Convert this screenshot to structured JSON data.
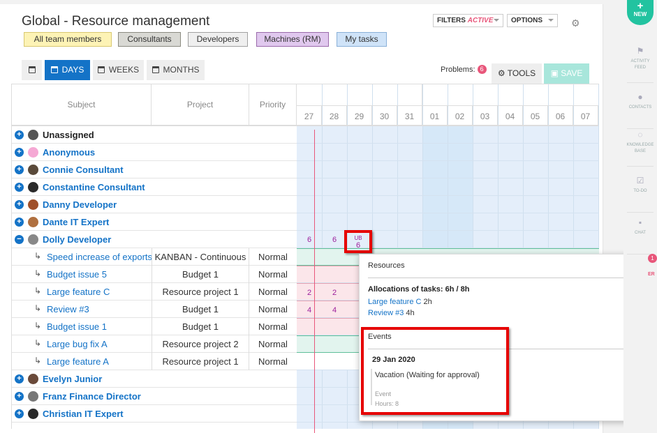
{
  "header": {
    "title": "Global - Resource management",
    "filters_label": "FILTERS",
    "filters_state": "ACTIVE",
    "options_label": "OPTIONS"
  },
  "chips": [
    {
      "label": "All team members",
      "bg": "#fdf3b5",
      "border": "#d8c870"
    },
    {
      "label": "Consultants",
      "bg": "#d9d9d4",
      "border": "#8a8a80"
    },
    {
      "label": "Developers",
      "bg": "#efefef",
      "border": "#a0a0a0"
    },
    {
      "label": "Machines (RM)",
      "bg": "#e0c8ee",
      "border": "#9a6aaa"
    },
    {
      "label": "My tasks",
      "bg": "#cfe3f8",
      "border": "#8ab0d8"
    }
  ],
  "toolbar": {
    "days": "DAYS",
    "weeks": "WEEKS",
    "months": "MONTHS",
    "problems_label": "Problems:",
    "problems_count": "6",
    "tools": "TOOLS",
    "save": "SAVE"
  },
  "columns": {
    "subject": "Subject",
    "project": "Project",
    "priority": "Priority"
  },
  "days": [
    "27",
    "28",
    "29",
    "30",
    "31",
    "01",
    "02",
    "03",
    "04",
    "05",
    "06",
    "07"
  ],
  "rows": [
    {
      "type": "user",
      "name": "Unassigned",
      "black": true,
      "avatar": "#555"
    },
    {
      "type": "user",
      "name": "Anonymous",
      "avatar": "#f5a8d4"
    },
    {
      "type": "user",
      "name": "Connie Consultant",
      "avatar": "#5a4a3a"
    },
    {
      "type": "user",
      "name": "Constantine Consultant",
      "avatar": "#2a2a2a"
    },
    {
      "type": "user",
      "name": "Danny Developer",
      "avatar": "#a0502a"
    },
    {
      "type": "user",
      "name": "Dante IT Expert",
      "avatar": "#b07040"
    },
    {
      "type": "user",
      "name": "Dolly Developer",
      "avatar": "#888",
      "expanded": true
    },
    {
      "type": "task",
      "name": "Speed increase of exports",
      "project": "KANBAN - Continuous",
      "priority": "Normal",
      "bar": "green"
    },
    {
      "type": "task",
      "name": "Budget issue 5",
      "project": "Budget 1",
      "priority": "Normal",
      "bar": "red"
    },
    {
      "type": "task",
      "name": "Large feature C",
      "project": "Resource project 1",
      "priority": "Normal",
      "bar": "red",
      "vals": [
        "2",
        "2"
      ]
    },
    {
      "type": "task",
      "name": "Review #3",
      "project": "Budget 1",
      "priority": "Normal",
      "bar": "red",
      "vals": [
        "4",
        "4"
      ]
    },
    {
      "type": "task",
      "name": "Budget issue 1",
      "project": "Budget 1",
      "priority": "Normal",
      "bar": "red"
    },
    {
      "type": "task",
      "name": "Large bug fix A",
      "project": "Resource project 2",
      "priority": "Normal",
      "bar": "green"
    },
    {
      "type": "task",
      "name": "Large feature A",
      "project": "Resource project 1",
      "priority": "Normal",
      "bar": "none"
    },
    {
      "type": "user",
      "name": "Evelyn Junior",
      "avatar": "#6a4a3a"
    },
    {
      "type": "user",
      "name": "Franz Finance Director",
      "avatar": "#777"
    },
    {
      "type": "user",
      "name": "Christian IT Expert",
      "avatar": "#2a2a2a"
    }
  ],
  "dolly_values": [
    "6",
    "6"
  ],
  "ub_cell": {
    "tag": "UB",
    "value": "6"
  },
  "popup": {
    "resources_title": "Resources",
    "alloc_title": "Allocations of tasks: 6h / 8h",
    "alloc_items": [
      {
        "task": "Large feature C",
        "hours": "2h"
      },
      {
        "task": "Review #3",
        "hours": "4h"
      }
    ],
    "events_title": "Events",
    "event_date": "29 Jan 2020",
    "event_title": "Vacation (Waiting for approval)",
    "event_type": "Event",
    "event_hours": "Hours: 8"
  },
  "rail": {
    "new": "NEW",
    "items": [
      {
        "label1": "ACTIVITY",
        "label2": "FEED",
        "icon": "flag-icon"
      },
      {
        "label1": "CONTACTS",
        "label2": "",
        "icon": "person-icon"
      },
      {
        "label1": "KNOWLEDGE",
        "label2": "BASE",
        "icon": "bulb-icon"
      },
      {
        "label1": "TO-DO",
        "label2": "",
        "icon": "check-icon"
      },
      {
        "label1": "CHAT",
        "label2": "",
        "icon": "chat-icon"
      }
    ],
    "badge": "1",
    "partial": "ER"
  }
}
